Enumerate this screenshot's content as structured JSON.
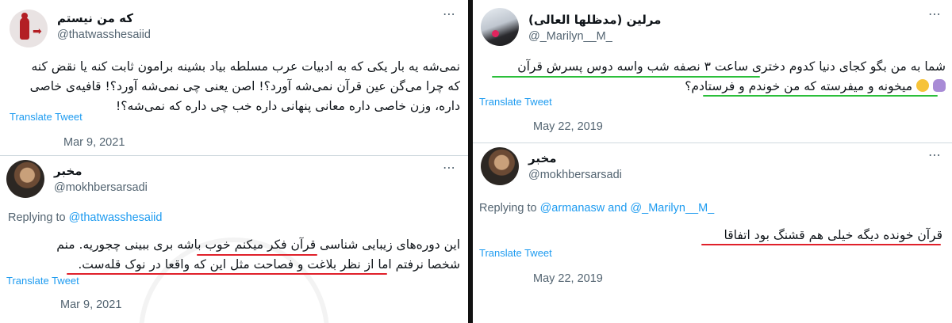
{
  "left_panel": {
    "tweet1": {
      "display_name": "که من نیستم",
      "handle": "@thatwasshesaiid",
      "text_lines": [
        "نمی‌شه یه بار یکی که به ادبیات عرب مسلطه بیاد بشینه برامون ثابت کنه یا نقض کنه",
        "که چرا می‌گن عین قرآن نمی‌شه آورد؟! اصن یعنی چی نمی‌شه آورد؟! قافیه‌ی خاصی",
        "داره، وزن خاصی داره معانی پنهانی داره خب چی داره که نمی‌شه؟!"
      ],
      "translate_label": "Translate Tweet",
      "date": "Mar 9, 2021",
      "more_icon": "more-options-icon"
    },
    "tweet2": {
      "display_name": "مخبر",
      "handle": "@mokhbersarsadi",
      "replying_prefix": "Replying to",
      "replying_to": "@thatwasshesaiid",
      "text_lines": [
        "این دوره‌های زیبایی شناسی قرآن فکر میکنم خوب باشه بری ببینی چجوریه. منم",
        "شخصا نرفتم اما از نظر بلاغت و فصاحت مثل این که واقعا در نوک قله‌ست."
      ],
      "translate_label": "Translate Tweet",
      "date": "Mar 9, 2021",
      "more_icon": "more-options-icon"
    }
  },
  "right_panel": {
    "tweet1": {
      "display_name": "مرلین (مدظلها العالی)",
      "handle": "@_Marilyn__M_",
      "text_lines": [
        "شما به من بگو کجای دنیا کدوم دختری ساعت ۳ نصفه شب واسه دوس پسرش قرآن",
        "میخونه و میفرسته که من خوندم و فرستادم؟"
      ],
      "translate_label": "Translate Tweet",
      "date": "May 22, 2019",
      "more_icon": "more-options-icon"
    },
    "tweet2": {
      "display_name": "مخبر",
      "handle": "@mokhbersarsadi",
      "replying_prefix": "Replying to",
      "replying_to": "@armanasw and @_Marilyn__M_",
      "text_lines": [
        "قرآن خونده دیگه خیلی هم قشنگ بود اتفاقا"
      ],
      "translate_label": "Translate Tweet",
      "date": "May 22, 2019",
      "more_icon": "more-options-icon"
    }
  },
  "colors": {
    "link_blue": "#1d9bf0",
    "secondary_gray": "#536471",
    "underline_red": "#e0202a",
    "underline_green": "#2bbf3a"
  }
}
